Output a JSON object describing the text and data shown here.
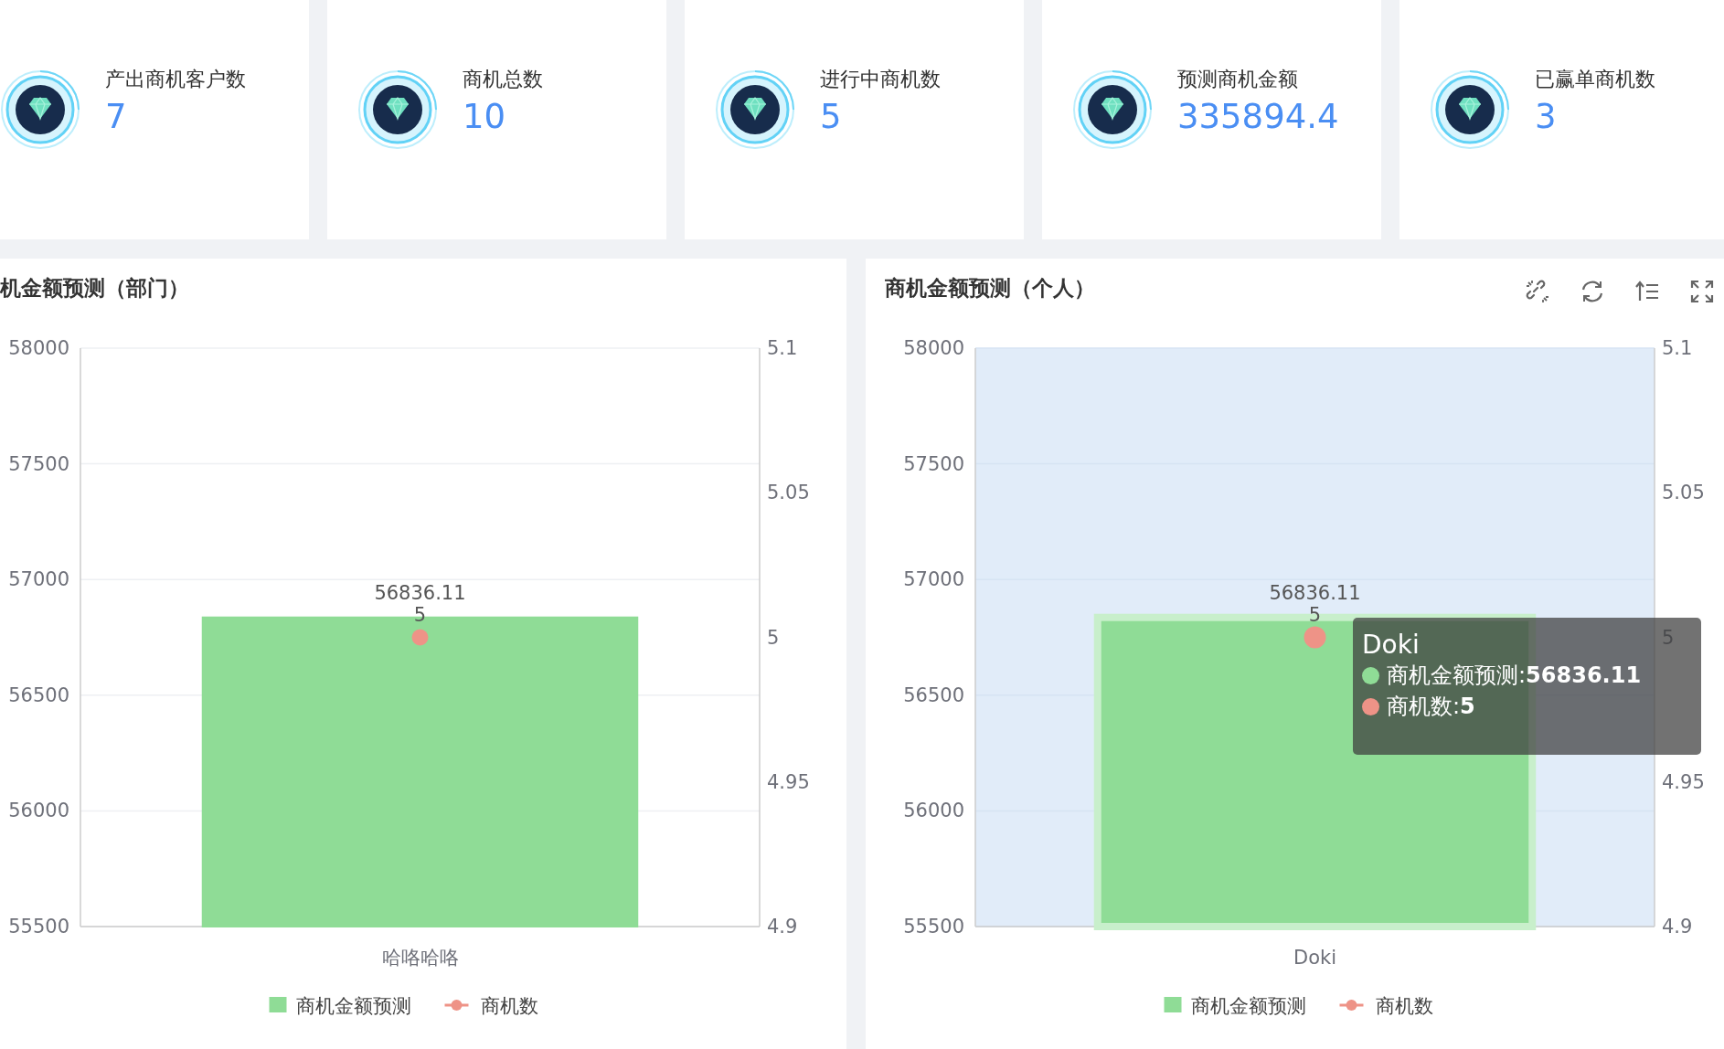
{
  "cards": [
    {
      "title": "产出商机客户数",
      "value": "7"
    },
    {
      "title": "商机总数",
      "value": "10"
    },
    {
      "title": "进行中商机数",
      "value": "5"
    },
    {
      "title": "预测商机金额",
      "value": "335894.4"
    },
    {
      "title": "已赢单商机数",
      "value": "3"
    }
  ],
  "panels": [
    {
      "title": "机金额预测（部门）",
      "toolbar": false,
      "hover_band": false,
      "chart_data": {
        "type": "bar",
        "categories": [
          "哈咯哈咯"
        ],
        "series": [
          {
            "name": "商机金额预测",
            "color": "#8fdc96",
            "values": [
              56836.11
            ]
          }
        ],
        "ylim": [
          55500,
          58000
        ],
        "yticks": [
          55500,
          56000,
          56500,
          57000,
          57500,
          58000
        ],
        "grid": true,
        "data_labels": true
      },
      "line_series": {
        "name": "商机数",
        "color": "#ee9387",
        "value": "5"
      },
      "right_axis": {
        "labels": [
          "5.1",
          "5.05",
          "5",
          "4.95",
          "4.9"
        ]
      }
    },
    {
      "title": "商机金额预测（个人）",
      "toolbar": true,
      "hover_band": true,
      "chart_data": {
        "type": "bar",
        "categories": [
          "Doki"
        ],
        "series": [
          {
            "name": "商机金额预测",
            "color": "#8fdc96",
            "values": [
              56836.11
            ]
          }
        ],
        "ylim": [
          55500,
          58000
        ],
        "yticks": [
          55500,
          56000,
          56500,
          57000,
          57500,
          58000
        ],
        "grid": true,
        "data_labels": true
      },
      "line_series": {
        "name": "商机数",
        "color": "#ee9387",
        "value": "5"
      },
      "right_axis": {
        "labels": [
          "5.1",
          "5.05",
          "5",
          "4.95",
          "4.9"
        ]
      },
      "tooltip": {
        "title": "Doki",
        "items": [
          {
            "text": "商机金额预测:**56836.11**",
            "color": "#8fdc96"
          },
          {
            "text": "商机数:**5**",
            "color": "#ee9387"
          }
        ]
      }
    }
  ]
}
